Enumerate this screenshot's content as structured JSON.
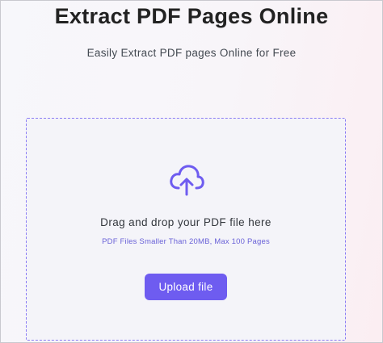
{
  "header": {
    "title": "Extract PDF Pages Online",
    "subtitle": "Easily Extract PDF pages Online for Free"
  },
  "dropzone": {
    "icon": "cloud-upload-icon",
    "instruction": "Drag and drop your PDF file here",
    "limits": "PDF Files Smaller Than 20MB, Max 100 Pages",
    "button_label": "Upload file"
  },
  "colors": {
    "accent": "#6e5cf0",
    "dropzone_border": "#8b7cf4",
    "limits_text": "#6a62d8"
  }
}
